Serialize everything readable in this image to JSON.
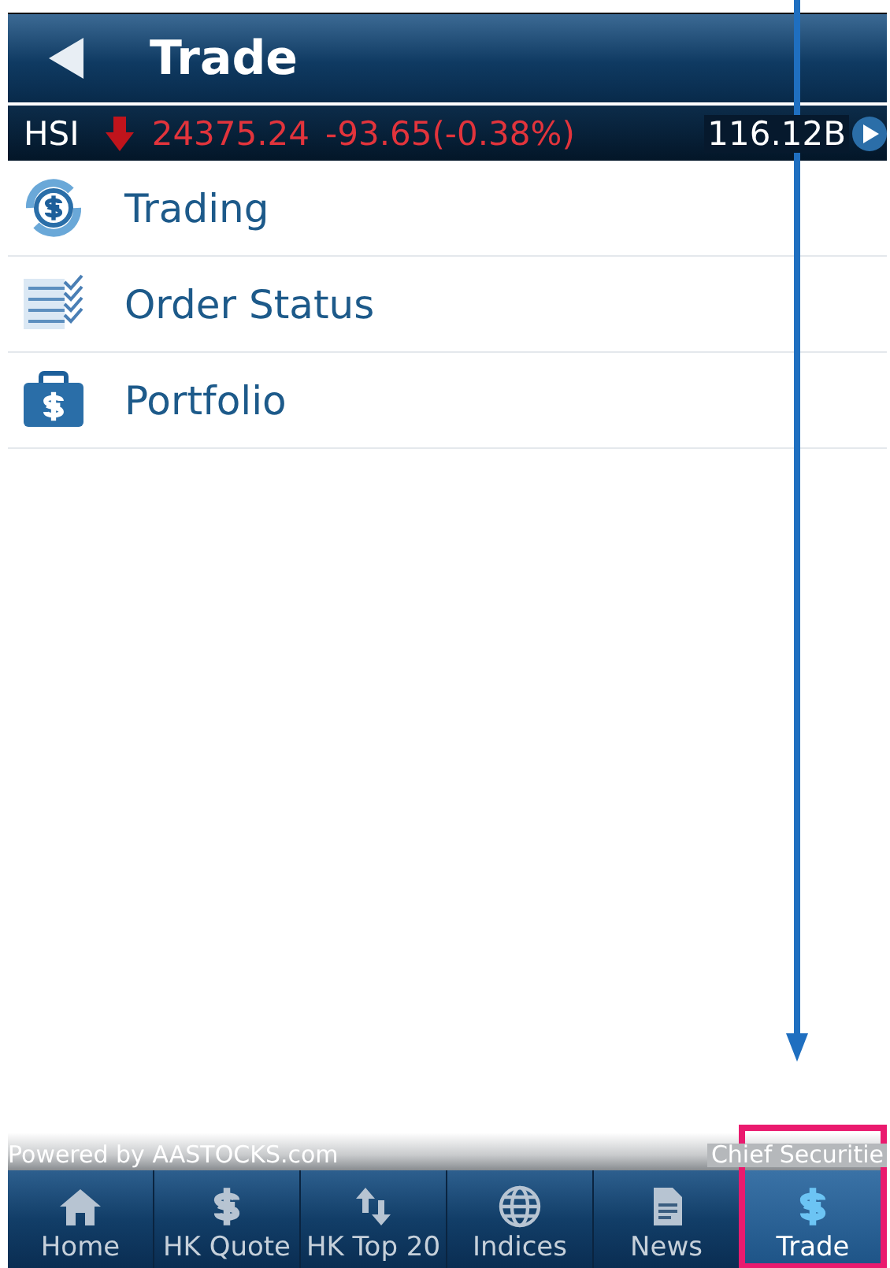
{
  "header": {
    "title": "Trade"
  },
  "index_bar": {
    "name": "HSI",
    "last": "24375.24",
    "change": "-93.65(-0.38%)",
    "turnover": "116.12B"
  },
  "menu": [
    {
      "label": "Trading"
    },
    {
      "label": "Order Status"
    },
    {
      "label": "Portfolio"
    }
  ],
  "footer": {
    "left": "Powered by AASTOCKS.com",
    "right": "Chief Securitie"
  },
  "tabs": [
    {
      "label": "Home",
      "selected": false
    },
    {
      "label": "HK Quote",
      "selected": false
    },
    {
      "label": "HK Top 20",
      "selected": false
    },
    {
      "label": "Indices",
      "selected": false
    },
    {
      "label": "News",
      "selected": false
    },
    {
      "label": "Trade",
      "selected": true
    }
  ]
}
